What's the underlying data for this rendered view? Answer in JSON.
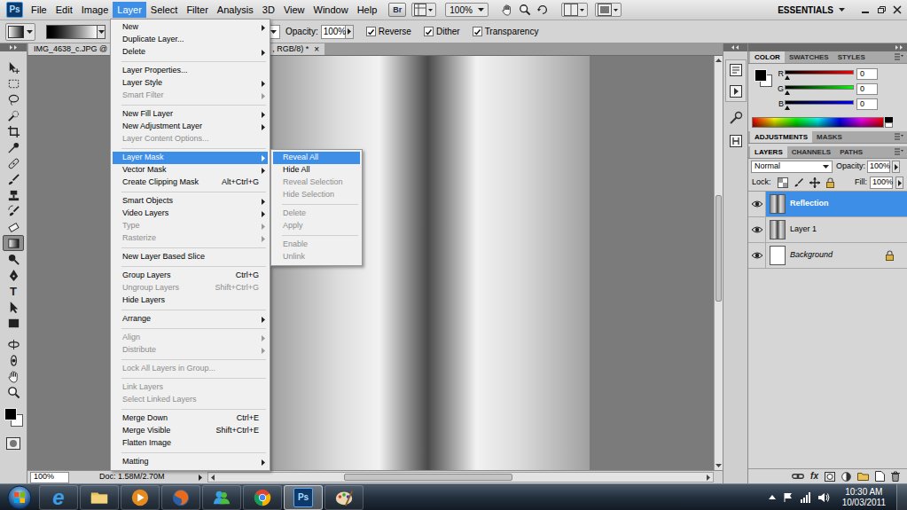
{
  "app": {
    "logo": "Ps",
    "bridge": "Br",
    "zoom": "100%",
    "workspace": "ESSENTIALS"
  },
  "menubar": [
    {
      "label": "File",
      "selected": false
    },
    {
      "label": "Edit",
      "selected": false
    },
    {
      "label": "Image",
      "selected": false
    },
    {
      "label": "Layer",
      "selected": true
    },
    {
      "label": "Select",
      "selected": false
    },
    {
      "label": "Filter",
      "selected": false
    },
    {
      "label": "Analysis",
      "selected": false
    },
    {
      "label": "3D",
      "selected": false
    },
    {
      "label": "View",
      "selected": false
    },
    {
      "label": "Window",
      "selected": false
    },
    {
      "label": "Help",
      "selected": false
    }
  ],
  "options": {
    "opacity_label": "Opacity:",
    "opacity": "100%",
    "checks": [
      {
        "label": "Reverse",
        "checked": true
      },
      {
        "label": "Dither",
        "checked": true
      },
      {
        "label": "Transparency",
        "checked": true
      }
    ]
  },
  "toolbar": {
    "tools": [
      {
        "kind": "move",
        "selected": false
      },
      {
        "kind": "marquee",
        "selected": false
      },
      {
        "kind": "lasso",
        "selected": false
      },
      {
        "kind": "quickselect",
        "selected": false
      },
      {
        "kind": "crop",
        "selected": false
      },
      {
        "kind": "eyedropper",
        "selected": false
      },
      {
        "kind": "healing",
        "selected": false
      },
      {
        "kind": "brush",
        "selected": false
      },
      {
        "kind": "clone",
        "selected": false
      },
      {
        "kind": "history",
        "selected": false
      },
      {
        "kind": "eraser",
        "selected": false
      },
      {
        "kind": "gradient",
        "selected": true
      },
      {
        "kind": "dodge",
        "selected": false
      },
      {
        "kind": "pen",
        "selected": false
      },
      {
        "kind": "type",
        "selected": false,
        "label": "T"
      },
      {
        "kind": "pathselect",
        "selected": false
      },
      {
        "kind": "shape",
        "selected": false
      },
      {
        "kind": "rotate3d",
        "selected": false
      },
      {
        "kind": "orbit3d",
        "selected": false
      },
      {
        "kind": "hand",
        "selected": false
      },
      {
        "kind": "zoom",
        "selected": false
      }
    ]
  },
  "document": {
    "tab_left": "IMG_4638_c.JPG @ 50",
    "tab_right": ", RGB/8) *",
    "close": "×"
  },
  "scrollbars": {
    "horizontal": {
      "level": 0.4
    },
    "vertical": {
      "level": 0.45
    }
  },
  "status": {
    "zoom": "100%",
    "doc": "Doc: 1.58M/2.70M"
  },
  "layer_menu": {
    "items": [
      {
        "kind": "item",
        "label": "New",
        "submenu": true,
        "disabled": false,
        "selected": false
      },
      {
        "kind": "item",
        "label": "Duplicate Layer...",
        "submenu": false,
        "disabled": false,
        "selected": false
      },
      {
        "kind": "item",
        "label": "Delete",
        "submenu": true,
        "disabled": false,
        "selected": false
      },
      {
        "kind": "separator"
      },
      {
        "kind": "item",
        "label": "Layer Properties...",
        "submenu": false,
        "disabled": false,
        "selected": false
      },
      {
        "kind": "item",
        "label": "Layer Style",
        "submenu": true,
        "disabled": false,
        "selected": false
      },
      {
        "kind": "item",
        "label": "Smart Filter",
        "submenu": true,
        "disabled": true,
        "selected": false
      },
      {
        "kind": "separator"
      },
      {
        "kind": "item",
        "label": "New Fill Layer",
        "submenu": true,
        "disabled": false,
        "selected": false
      },
      {
        "kind": "item",
        "label": "New Adjustment Layer",
        "submenu": true,
        "disabled": false,
        "selected": false
      },
      {
        "kind": "item",
        "label": "Layer Content Options...",
        "submenu": false,
        "disabled": true,
        "selected": false
      },
      {
        "kind": "separator"
      },
      {
        "kind": "item",
        "label": "Layer Mask",
        "submenu": true,
        "disabled": false,
        "selected": true
      },
      {
        "kind": "item",
        "label": "Vector Mask",
        "submenu": true,
        "disabled": false,
        "selected": false
      },
      {
        "kind": "item",
        "label": "Create Clipping Mask",
        "shortcut": "Alt+Ctrl+G",
        "submenu": false,
        "disabled": false,
        "selected": false
      },
      {
        "kind": "separator"
      },
      {
        "kind": "item",
        "label": "Smart Objects",
        "submenu": true,
        "disabled": false,
        "selected": false
      },
      {
        "kind": "item",
        "label": "Video Layers",
        "submenu": true,
        "disabled": false,
        "selected": false
      },
      {
        "kind": "item",
        "label": "Type",
        "submenu": true,
        "disabled": true,
        "selected": false
      },
      {
        "kind": "item",
        "label": "Rasterize",
        "submenu": true,
        "disabled": true,
        "selected": false
      },
      {
        "kind": "separator"
      },
      {
        "kind": "item",
        "label": "New Layer Based Slice",
        "submenu": false,
        "disabled": false,
        "selected": false
      },
      {
        "kind": "separator"
      },
      {
        "kind": "item",
        "label": "Group Layers",
        "shortcut": "Ctrl+G",
        "submenu": false,
        "disabled": false,
        "selected": false
      },
      {
        "kind": "item",
        "label": "Ungroup Layers",
        "shortcut": "Shift+Ctrl+G",
        "submenu": false,
        "disabled": true,
        "selected": false
      },
      {
        "kind": "item",
        "label": "Hide Layers",
        "submenu": false,
        "disabled": false,
        "selected": false
      },
      {
        "kind": "separator"
      },
      {
        "kind": "item",
        "label": "Arrange",
        "submenu": true,
        "disabled": false,
        "selected": false
      },
      {
        "kind": "separator"
      },
      {
        "kind": "item",
        "label": "Align",
        "submenu": true,
        "disabled": true,
        "selected": false
      },
      {
        "kind": "item",
        "label": "Distribute",
        "submenu": true,
        "disabled": true,
        "selected": false
      },
      {
        "kind": "separator"
      },
      {
        "kind": "item",
        "label": "Lock All Layers in Group...",
        "submenu": false,
        "disabled": true,
        "selected": false
      },
      {
        "kind": "separator"
      },
      {
        "kind": "item",
        "label": "Link Layers",
        "submenu": false,
        "disabled": true,
        "selected": false
      },
      {
        "kind": "item",
        "label": "Select Linked Layers",
        "submenu": false,
        "disabled": true,
        "selected": false
      },
      {
        "kind": "separator"
      },
      {
        "kind": "item",
        "label": "Merge Down",
        "shortcut": "Ctrl+E",
        "submenu": false,
        "disabled": false,
        "selected": false
      },
      {
        "kind": "item",
        "label": "Merge Visible",
        "shortcut": "Shift+Ctrl+E",
        "submenu": false,
        "disabled": false,
        "selected": false
      },
      {
        "kind": "item",
        "label": "Flatten Image",
        "submenu": false,
        "disabled": false,
        "selected": false
      },
      {
        "kind": "separator"
      },
      {
        "kind": "item",
        "label": "Matting",
        "submenu": true,
        "disabled": false,
        "selected": false
      }
    ]
  },
  "mask_submenu": {
    "items": [
      {
        "kind": "item",
        "label": "Reveal All",
        "submenu": false,
        "disabled": false,
        "selected": true
      },
      {
        "kind": "item",
        "label": "Hide All",
        "submenu": false,
        "disabled": false,
        "selected": false
      },
      {
        "kind": "item",
        "label": "Reveal Selection",
        "submenu": false,
        "disabled": true,
        "selected": false
      },
      {
        "kind": "item",
        "label": "Hide Selection",
        "submenu": false,
        "disabled": true,
        "selected": false
      },
      {
        "kind": "separator"
      },
      {
        "kind": "item",
        "label": "Delete",
        "submenu": false,
        "disabled": true,
        "selected": false
      },
      {
        "kind": "item",
        "label": "Apply",
        "submenu": false,
        "disabled": true,
        "selected": false
      },
      {
        "kind": "separator"
      },
      {
        "kind": "item",
        "label": "Enable",
        "submenu": false,
        "disabled": true,
        "selected": false
      },
      {
        "kind": "item",
        "label": "Unlink",
        "submenu": false,
        "disabled": true,
        "selected": false
      }
    ]
  },
  "panels": {
    "color": {
      "tabs": [
        {
          "label": "COLOR",
          "selected": true
        },
        {
          "label": "SWATCHES",
          "selected": false
        },
        {
          "label": "STYLES",
          "selected": false
        }
      ],
      "channels": [
        {
          "label": "R",
          "value": "0",
          "level": 0,
          "color": "#ff0000"
        },
        {
          "label": "G",
          "value": "0",
          "level": 0,
          "color": "#00ff00"
        },
        {
          "label": "B",
          "value": "0",
          "level": 0,
          "color": "#0000ff"
        }
      ]
    },
    "adjustments": {
      "tabs": [
        {
          "label": "ADJUSTMENTS",
          "selected": true
        },
        {
          "label": "MASKS",
          "selected": false
        }
      ]
    },
    "layers": {
      "tabs": [
        {
          "label": "LAYERS",
          "selected": true
        },
        {
          "label": "CHANNELS",
          "selected": false
        },
        {
          "label": "PATHS",
          "selected": false
        }
      ],
      "blend": "Normal",
      "opacity_label": "Opacity:",
      "opacity": "100%",
      "lock_label": "Lock:",
      "fill_label": "Fill:",
      "fill": "100%",
      "items": [
        {
          "name": "Reflection",
          "selected": true,
          "visible": true,
          "locked": false,
          "italic": false,
          "kind": "photo"
        },
        {
          "name": "Layer 1",
          "selected": false,
          "visible": true,
          "locked": false,
          "italic": false,
          "kind": "photo"
        },
        {
          "name": "Background",
          "selected": false,
          "visible": true,
          "locked": true,
          "italic": true,
          "kind": "blank"
        }
      ],
      "fx": "fx"
    }
  },
  "taskbar": {
    "apps": [
      {
        "kind": "ie",
        "active": false,
        "label": "e"
      },
      {
        "kind": "explorer",
        "active": false
      },
      {
        "kind": "media",
        "active": false
      },
      {
        "kind": "firefox",
        "active": false
      },
      {
        "kind": "messenger",
        "active": false
      },
      {
        "kind": "chrome",
        "active": false
      },
      {
        "kind": "photoshop",
        "active": true,
        "label": "Ps"
      },
      {
        "kind": "paint",
        "active": false
      }
    ],
    "time": "10:30 AM",
    "date": "10/03/2011"
  }
}
